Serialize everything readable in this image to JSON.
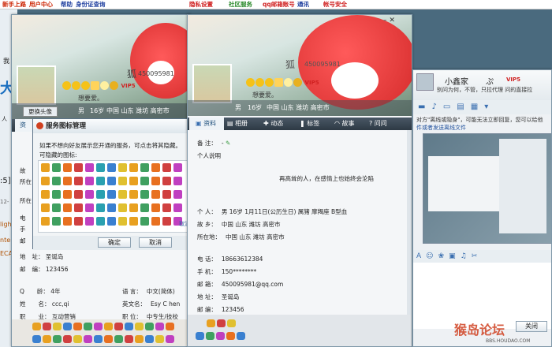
{
  "topbar": {
    "links": [
      "新手上路",
      "用户中心",
      "帮助",
      "身份证查询"
    ],
    "right_links": [
      "隐私设置",
      "社区服务",
      "qq邮箱账号",
      "通讯",
      "帐号安全"
    ],
    "colors": {
      "left": "#cc2200",
      "mid": "#1f3f9f",
      "green": "#2a8a2a",
      "red": "#d02020"
    }
  },
  "bg_page": {
    "texts": [
      "我",
      "大",
      "人",
      ":5]",
      "12-",
      "ligh",
      "nte",
      "ECA"
    ]
  },
  "win_left": {
    "nick": "狐",
    "qq": "450095981",
    "signature": "想要爱。",
    "vip": "VIP5",
    "gender": "男",
    "age": "16岁",
    "location": "中国 山东 潍坊 高密市",
    "change_avatar": "更换头像",
    "tab_profile": "资",
    "rows": [
      {
        "label": "故",
        "value": ""
      },
      {
        "label": "所在",
        "value": ""
      },
      {
        "label": "电",
        "value": ""
      },
      {
        "label": "手",
        "value": ""
      },
      {
        "label": "邮",
        "value": ""
      },
      {
        "label": "地",
        "value": "址：   圣诞岛"
      },
      {
        "label": "邮",
        "value": "编：   123456"
      }
    ],
    "extra": [
      {
        "l": "Q",
        "v": "龄：   4年",
        "l2": "语   言：",
        "v2": "中文(简体)"
      },
      {
        "l": "姓",
        "v": "名：   ccc,qi",
        "l2": "英文名：",
        "v2": "Esy C hen"
      },
      {
        "l": "职",
        "v": "业：   互动营销",
        "l2": "职   位：",
        "v2": "中专生/技校"
      }
    ]
  },
  "dialog": {
    "title": "服务图标管理",
    "desc1": "如果不想向好友展示您开通的服务，可点击将其隐藏。",
    "desc2": "可隐藏的图标:",
    "ok": "确定",
    "cancel": "取消",
    "hide_side": "取消"
  },
  "win_mid": {
    "nick": "狐",
    "qq": "450095981",
    "signature": "想要爱。",
    "vip": "VIP5",
    "gender": "男",
    "age": "16岁",
    "location": "中国 山东 潍坊 高密市",
    "tabs": [
      "资料",
      "相册",
      "动态",
      "标签",
      "故事",
      "问问"
    ],
    "note_label": "备   注：",
    "note_value": "-",
    "desc_label": "个人说明",
    "desc_text": "再高耸的人，在感情上也始终会沦陷",
    "personal_label": "个   人：",
    "personal_value": "男   16岁      1月11日(公历生日)  属猪   摩羯座   B型血",
    "hometown_label": "故   乡：",
    "hometown_value": "中国 山东 潍坊 高密市",
    "location_label": "所在地：",
    "location_value": "中国 山东 潍坊 高密市",
    "phone_label": "电   话：",
    "phone_value": "18663612384",
    "mobile_label": "手   机：",
    "mobile_value": "150********",
    "email_label": "邮   箱：",
    "email_value": "450095981@qq.com",
    "addr_label": "地   址：",
    "addr_value": "圣诞岛",
    "zip_label": "邮   编：",
    "zip_value": "123456"
  },
  "win_right": {
    "nick": "小鑫家",
    "nick2": "ぷ",
    "vip": "VIP5",
    "status": "别问为何，不管，只拉代理 问的直接拉",
    "notice": "对方\"离线或隐身\"，可能无法立即回复，您可以给他",
    "notice_link": "件或者发送离线文件",
    "send": "关闭",
    "watermark": "猴岛论坛",
    "watermark_url": "BBS.HOUDAO.COM"
  }
}
